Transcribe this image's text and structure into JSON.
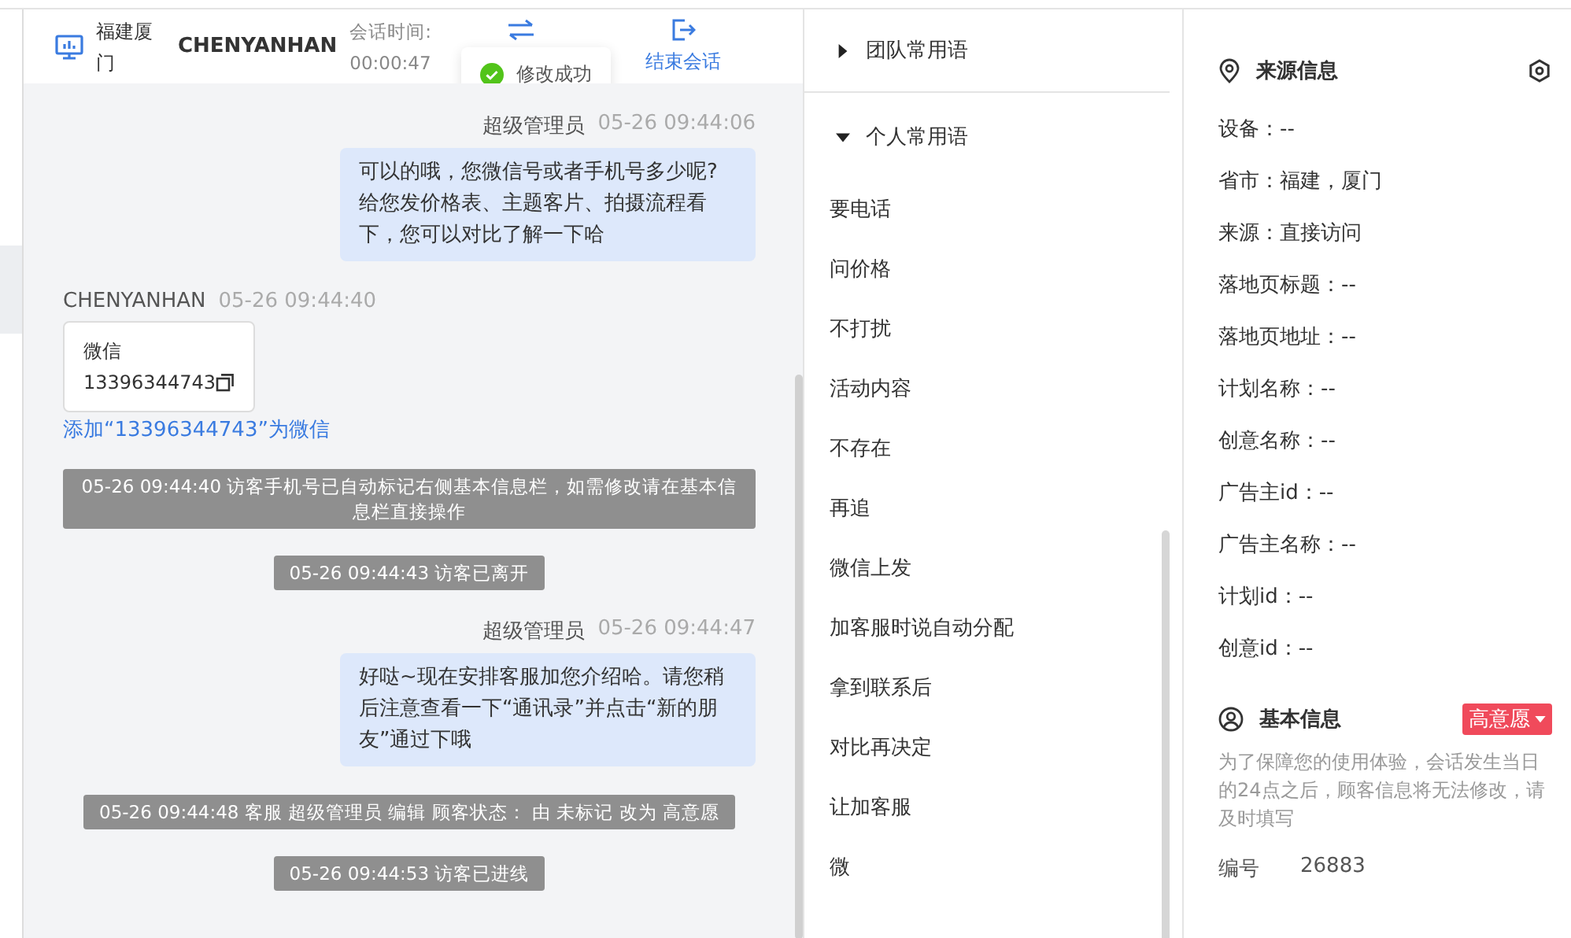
{
  "header": {
    "location": "福建厦门",
    "visitor_name": "CHENYANHAN",
    "session_time_label": "会话时间:",
    "session_time": "00:00:47",
    "end_button": "结束会话"
  },
  "toast": {
    "text": "修改成功"
  },
  "messages": [
    {
      "kind": "agent",
      "sender": "超级管理员",
      "time": "05-26 09:44:06",
      "text": "可以的哦，您微信号或者手机号多少呢?给您发价格表、主题客片、拍摄流程看下，您可以对比了解一下哈"
    },
    {
      "kind": "card",
      "sender": "CHENYANHAN",
      "time": "05-26 09:44:40",
      "card_title": "微信",
      "card_value": "13396344743",
      "link": "添加“13396344743”为微信"
    },
    {
      "kind": "system",
      "text": "05-26 09:44:40 访客手机号已自动标记右侧基本信息栏，如需修改请在基本信息栏直接操作"
    },
    {
      "kind": "system",
      "text": "05-26 09:44:43 访客已离开"
    },
    {
      "kind": "agent",
      "sender": "超级管理员",
      "time": "05-26 09:44:47",
      "text": "好哒~现在安排客服加您介绍哈。请您稍后注意查看一下“通讯录”并点击“新的朋友”通过下哦"
    },
    {
      "kind": "system",
      "text": "05-26 09:44:48 客服 超级管理员 编辑 顾客状态： 由 未标记 改为 高意愿"
    },
    {
      "kind": "system",
      "text": "05-26 09:44:53 访客已进线"
    }
  ],
  "phrase_groups": [
    {
      "title": "团队常用语",
      "expanded": false
    },
    {
      "title": "个人常用语",
      "expanded": true,
      "items": [
        "要电话",
        "问价格",
        "不打扰",
        "活动内容",
        "不存在",
        "再追",
        "微信上发",
        "加客服时说自动分配",
        "拿到联系后",
        "对比再决定",
        "让加客服",
        "微"
      ]
    }
  ],
  "source_info": {
    "title": "来源信息",
    "fields": [
      "设备：--",
      "省市：福建，厦门",
      "来源：直接访问",
      "落地页标题：--",
      "落地页地址：--",
      "计划名称：--",
      "创意名称：--",
      "广告主id：--",
      "广告主名称：--",
      "计划id：--",
      "创意id：--"
    ]
  },
  "basic_info": {
    "title": "基本信息",
    "status_tag": "高意愿",
    "note": "为了保障您的使用体验，会话发生当日的24点之后，顾客信息将无法修改，请及时填写",
    "fields": [
      {
        "label": "编号",
        "value": "26883"
      }
    ]
  }
}
